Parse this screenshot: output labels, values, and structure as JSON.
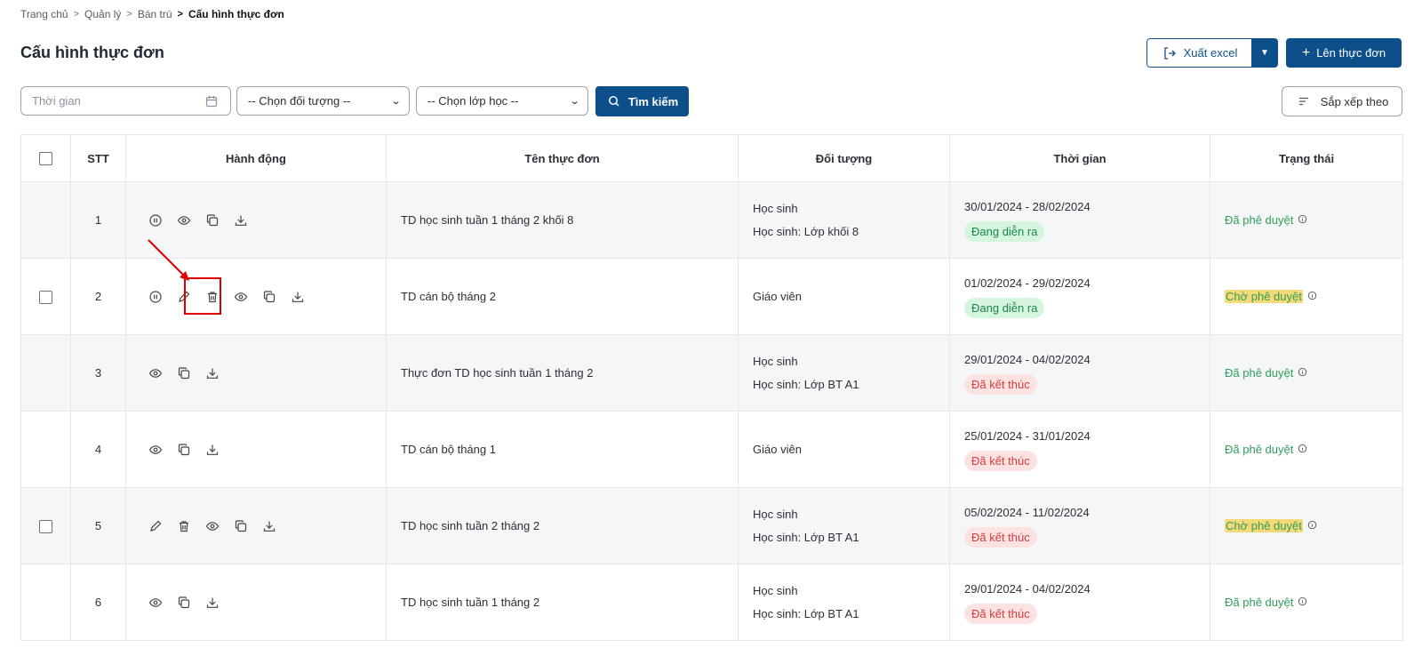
{
  "breadcrumb": {
    "items": [
      "Trang chủ",
      "Quản lý",
      "Bán trú"
    ],
    "current": "Cấu hình thực đơn"
  },
  "page": {
    "title": "Cấu hình thực đơn"
  },
  "toolbar": {
    "export_label": "Xuất excel",
    "new_menu_label": "Lên thực đơn",
    "sort_label": "Sắp xếp theo",
    "search_label": "Tìm kiếm"
  },
  "filters": {
    "date_placeholder": "Thời gian",
    "target_select": "-- Chọn đối tượng --",
    "class_select": "-- Chọn lớp học --"
  },
  "table": {
    "headers": [
      "STT",
      "Hành động",
      "Tên thực đơn",
      "Đối tượng",
      "Thời gian",
      "Trạng thái"
    ],
    "rows": [
      {
        "stt": "1",
        "name": "TD học sinh tuần 1 tháng 2 khối 8",
        "target": [
          "Học sinh",
          "Học sinh: Lớp khối 8"
        ],
        "range": "30/01/2024 - 28/02/2024",
        "phase": "Đang diễn ra",
        "status": "Đã phê duyệt"
      },
      {
        "stt": "2",
        "name": "TD cán bộ tháng 2",
        "target": [
          "Giáo viên"
        ],
        "range": "01/02/2024 - 29/02/2024",
        "phase": "Đang diễn ra",
        "status": "Chờ phê duyệt"
      },
      {
        "stt": "3",
        "name": "Thực đơn TD học sinh tuần 1 tháng 2",
        "target": [
          "Học sinh",
          "Học sinh: Lớp BT A1"
        ],
        "range": "29/01/2024 - 04/02/2024",
        "phase": "Đã kết thúc",
        "status": "Đã phê duyệt"
      },
      {
        "stt": "4",
        "name": "TD cán bộ tháng 1",
        "target": [
          "Giáo viên"
        ],
        "range": "25/01/2024 - 31/01/2024",
        "phase": "Đã kết thúc",
        "status": "Đã phê duyệt"
      },
      {
        "stt": "5",
        "name": "TD học sinh tuần 2 tháng 2",
        "target": [
          "Học sinh",
          "Học sinh: Lớp BT A1"
        ],
        "range": "05/02/2024 - 11/02/2024",
        "phase": "Đã kết thúc",
        "status": "Chờ phê duyệt"
      },
      {
        "stt": "6",
        "name": "TD học sinh tuần 1 tháng 2",
        "target": [
          "Học sinh",
          "Học sinh: Lớp BT A1"
        ],
        "range": "29/01/2024 - 04/02/2024",
        "phase": "Đã kết thúc",
        "status": "Đã phê duyệt"
      }
    ]
  },
  "colors": {
    "primary": "#0d4f8b",
    "approved_text": "#2f9e5b",
    "pending_highlight": "#f5d977",
    "running_badge_bg": "#d5f5df",
    "ended_badge_bg": "#fde2e2",
    "annotation": "#e00000"
  }
}
